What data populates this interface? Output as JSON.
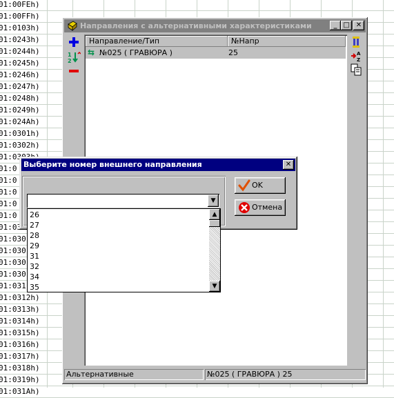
{
  "background": {
    "rows": [
      "01:00FEh)",
      "01:00FFh)",
      "01:0103h)",
      "01:0243h)",
      "01:0244h)",
      "01:0245h)",
      "01:0246h)",
      "01:0247h)",
      "01:0248h)",
      "01:0249h)",
      "01:024Ah)",
      "01:0301h)",
      "01:0302h)",
      "01:0303h)",
      "01:0",
      "01:0",
      "01:0",
      "01:0",
      "01:0",
      "01:030",
      "01:030",
      "01:030",
      "01:030",
      "01:030",
      "01:031",
      "01:0312h)",
      "01:0313h)",
      "01:0314h)",
      "01:0315h)",
      "01:0316h)",
      "01:0317h)",
      "01:0318h)",
      "01:0319h)",
      "01:031Ah)"
    ]
  },
  "window": {
    "title": "Направления с альтернативными характеристиками",
    "controls": {
      "minimize": "_",
      "maximize": "□",
      "close": "✕"
    },
    "columns": [
      "Направление/Тип",
      "№Напр"
    ],
    "rows": [
      {
        "name": "№025 ( ГРАВЮРА )",
        "number": "25"
      }
    ],
    "left_toolbar": [
      {
        "icon": "add-icon",
        "color": "#0000e0"
      },
      {
        "icon": "swap-icon",
        "color": "#00904a"
      },
      {
        "icon": "remove-icon",
        "color": "#e00000"
      }
    ],
    "right_toolbar": [
      {
        "icon": "filter-icon"
      },
      {
        "icon": "sort-icon"
      },
      {
        "icon": "copy-icon"
      }
    ],
    "status": {
      "left": "Альтернативные",
      "right": "№025 ( ГРАВЮРА ) 25"
    }
  },
  "dialog": {
    "title": "Выберите номер внешнего направления",
    "combo_value": "",
    "ok_label": "OK",
    "cancel_label": "Отмена",
    "options": [
      "26",
      "27",
      "28",
      "29",
      "31",
      "32",
      "34",
      "35"
    ]
  },
  "colors": {
    "accent": "#000080",
    "selection": "#c0c0c0"
  }
}
